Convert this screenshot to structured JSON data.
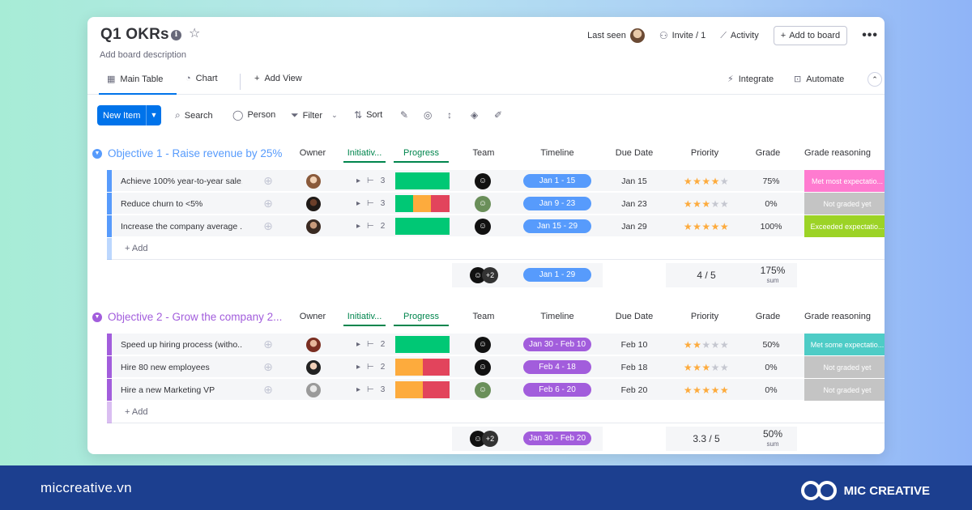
{
  "board": {
    "title": "Q1 OKRs",
    "description": "Add board description",
    "header_actions": {
      "last_seen": "Last seen",
      "invite": "Invite / 1",
      "activity": "Activity",
      "add_to_board": "Add to board"
    }
  },
  "tabs": {
    "main_table": "Main Table",
    "chart": "Chart",
    "add_view": "Add View",
    "integrate": "Integrate",
    "automate": "Automate"
  },
  "toolbar": {
    "new_item": "New Item",
    "search": "Search",
    "person": "Person",
    "filter": "Filter",
    "sort": "Sort"
  },
  "columns": {
    "owner": "Owner",
    "initiatives": "Initiativ...",
    "progress": "Progress",
    "team": "Team",
    "timeline": "Timeline",
    "due_date": "Due Date",
    "priority": "Priority",
    "grade": "Grade",
    "grade_reasoning": "Grade reasoning"
  },
  "groups": [
    {
      "title": "Objective 1 - Raise revenue by 25%",
      "color": "#579bfc",
      "rows": [
        {
          "name": "Achieve 100% year-to-year sale...",
          "initiatives": "3",
          "progress": [
            {
              "c": "#00c875",
              "w": 1
            }
          ],
          "timeline": "Jan 1 - 15",
          "due": "Jan 15",
          "stars": "★★★★",
          "stars_off": "★",
          "grade": "75%",
          "reason": "Met most expectatio...",
          "reason_color": "#ff7bd0"
        },
        {
          "name": "Reduce churn to <5%",
          "initiatives": "3",
          "progress": [
            {
              "c": "#00c875",
              "w": 0.33
            },
            {
              "c": "#fdab3d",
              "w": 0.33
            },
            {
              "c": "#e2445c",
              "w": 0.34
            }
          ],
          "timeline": "Jan 9 - 23",
          "due": "Jan 23",
          "stars": "★★★",
          "stars_off": "★★",
          "grade": "0%",
          "reason": "Not graded yet",
          "reason_color": "#c4c4c4"
        },
        {
          "name": "Increase the company average ...",
          "initiatives": "2",
          "progress": [
            {
              "c": "#00c875",
              "w": 1
            }
          ],
          "timeline": "Jan 15 - 29",
          "due": "Jan 29",
          "stars": "★★★★★",
          "stars_off": "",
          "grade": "100%",
          "reason": "Exceeded expectatio...",
          "reason_color": "#9cd326"
        }
      ],
      "add_label": "+ Add",
      "summary": {
        "team_extra": "+2",
        "timeline": "Jan 1 - 29",
        "priority": "4 / 5",
        "grade": "175%",
        "grade_sub": "sum"
      }
    },
    {
      "title": "Objective 2 - Grow the company 2...",
      "color": "#a25ddc",
      "rows": [
        {
          "name": "Speed up hiring process (witho...",
          "initiatives": "2",
          "progress": [
            {
              "c": "#00c875",
              "w": 1
            }
          ],
          "timeline": "Jan 30 - Feb 10",
          "due": "Feb 10",
          "stars": "★★",
          "stars_off": "★★★",
          "grade": "50%",
          "reason": "Met some expectatio...",
          "reason_color": "#4eccc6"
        },
        {
          "name": "Hire 80 new employees",
          "initiatives": "2",
          "progress": [
            {
              "c": "#fdab3d",
              "w": 0.5
            },
            {
              "c": "#e2445c",
              "w": 0.5
            }
          ],
          "timeline": "Feb 4 - 18",
          "due": "Feb 18",
          "stars": "★★★",
          "stars_off": "★★",
          "grade": "0%",
          "reason": "Not graded yet",
          "reason_color": "#c4c4c4"
        },
        {
          "name": "Hire a new Marketing VP",
          "initiatives": "3",
          "progress": [
            {
              "c": "#fdab3d",
              "w": 0.5
            },
            {
              "c": "#e2445c",
              "w": 0.5
            }
          ],
          "timeline": "Feb 6 - 20",
          "due": "Feb 20",
          "stars": "★★★★★",
          "stars_off": "",
          "grade": "0%",
          "reason": "Not graded yet",
          "reason_color": "#c4c4c4"
        }
      ],
      "add_label": "+ Add",
      "summary": {
        "team_extra": "+2",
        "timeline": "Jan 30 - Feb 20",
        "priority": "3.3 / 5",
        "grade": "50%",
        "grade_sub": "sum"
      }
    }
  ],
  "footer": {
    "site": "miccreative.vn",
    "brand": "MIC CREATIVE"
  }
}
